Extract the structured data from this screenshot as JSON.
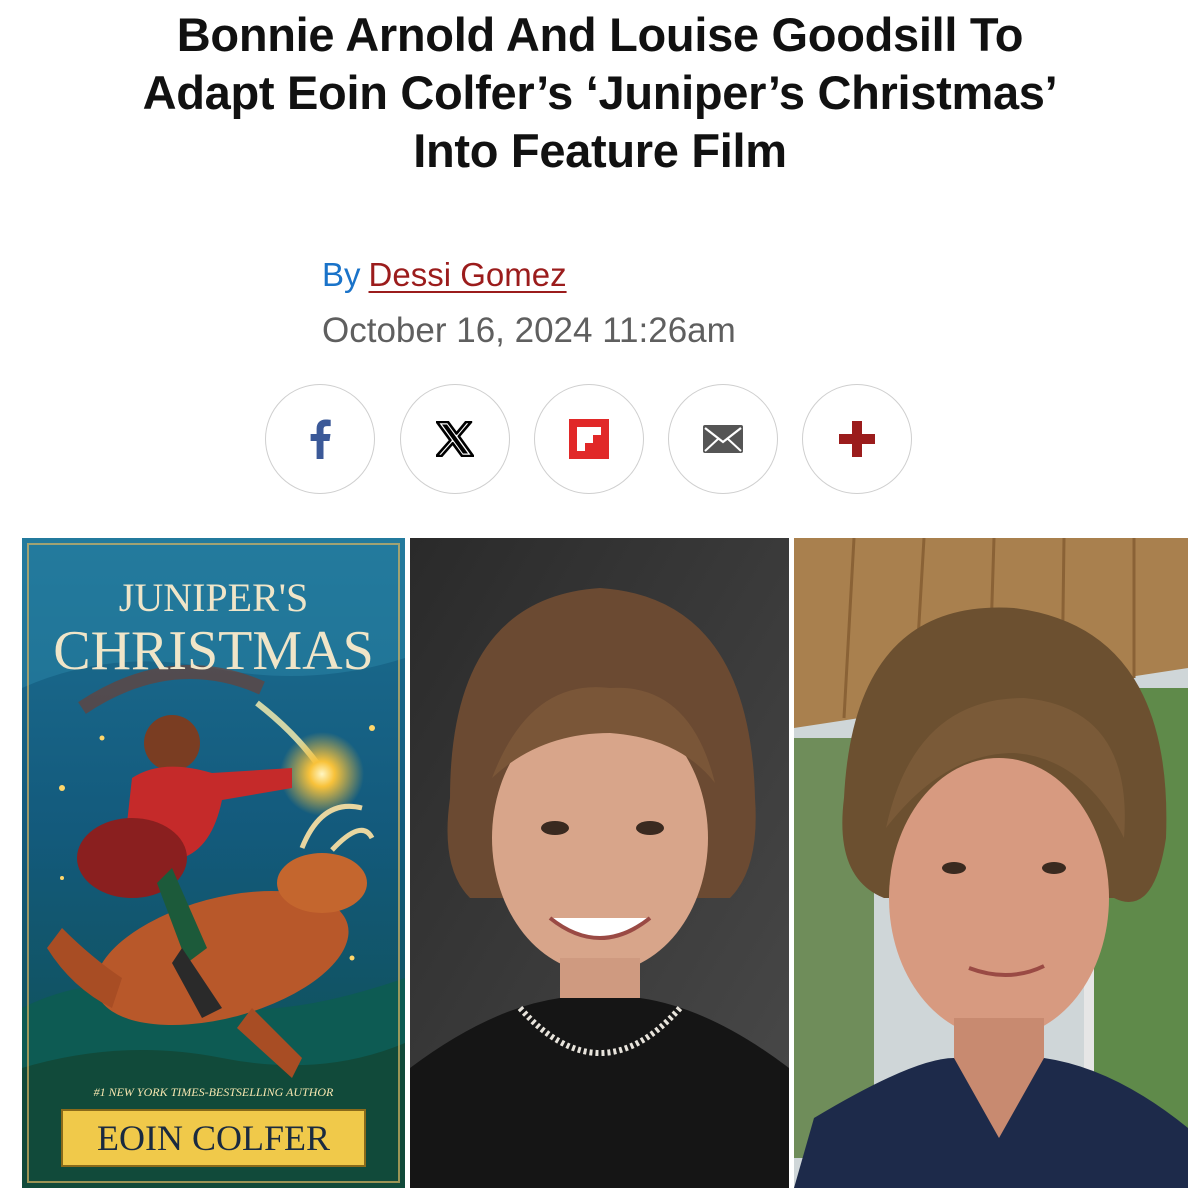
{
  "article": {
    "headline_lines": [
      "Bonnie Arnold And Louise Goodsill To",
      "Adapt Eoin Colfer’s ‘Juniper’s Christmas’",
      "Into Feature Film"
    ],
    "byline_prefix": "By",
    "author": "Dessi Gomez",
    "date": "October 16, 2024 11:26am"
  },
  "share": {
    "buttons": [
      {
        "name": "facebook",
        "icon": "facebook-icon",
        "color": "#3b5998"
      },
      {
        "name": "x",
        "icon": "x-icon",
        "color": "#000000"
      },
      {
        "name": "flipboard",
        "icon": "flipboard-icon",
        "color": "#e12828"
      },
      {
        "name": "email",
        "icon": "email-icon",
        "color": "#555555"
      },
      {
        "name": "more",
        "icon": "plus-icon",
        "color": "#9b1c1c"
      }
    ]
  },
  "images": {
    "book_cover": {
      "title_line1": "JUNIPER'S",
      "title_line2": "CHRISTMAS",
      "tagline": "#1 NEW YORK TIMES-BESTSELLING AUTHOR",
      "author_plate": "EOIN COLFER"
    }
  },
  "colors": {
    "headline": "#111111",
    "byline_prefix": "#1a73c9",
    "author_link": "#9b1c1c",
    "date": "#5f5f5f"
  }
}
